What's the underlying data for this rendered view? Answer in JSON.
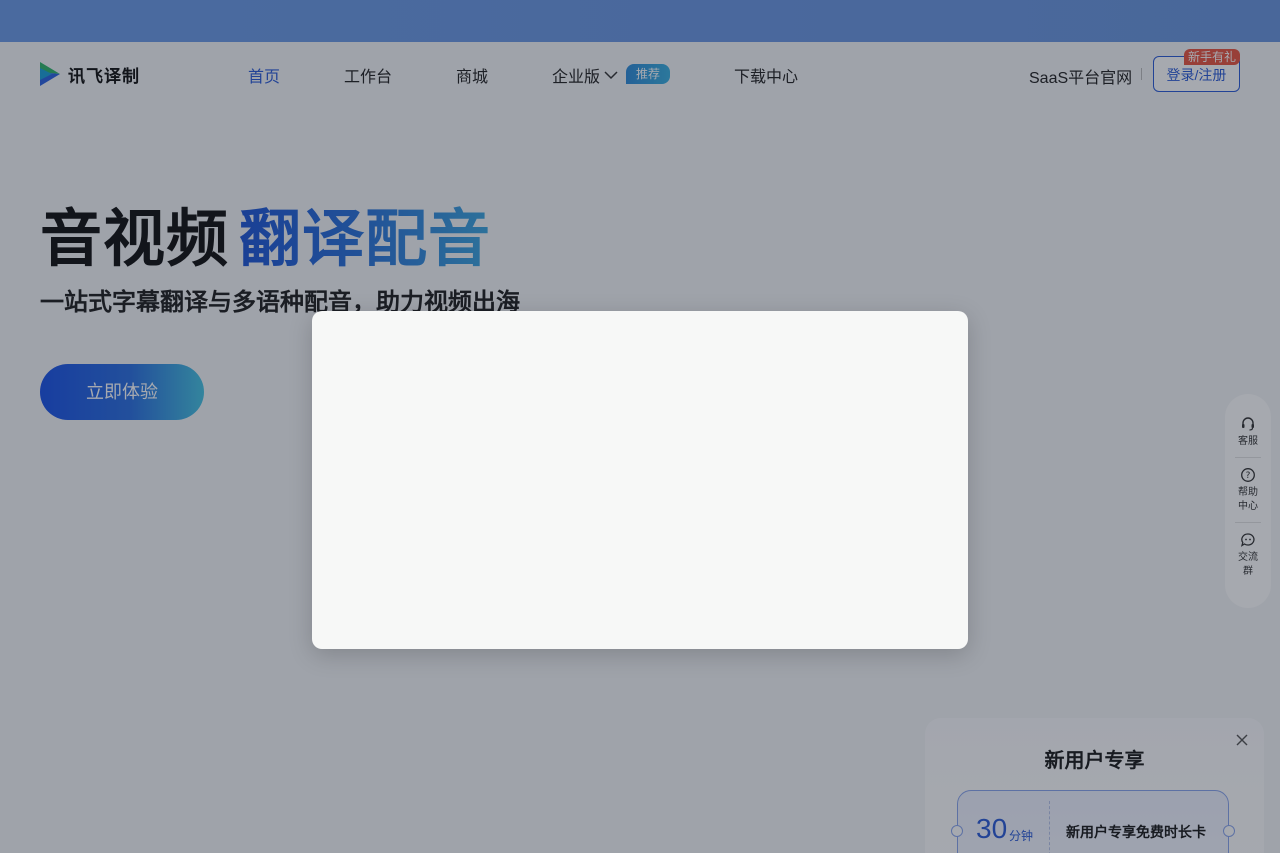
{
  "brand": {
    "name": "讯飞译制",
    "colors": {
      "primary": "#2b5bd7",
      "accent": "#3ca6de",
      "gift": "#e9553f"
    }
  },
  "nav": {
    "items": [
      {
        "label": "首页",
        "active": true
      },
      {
        "label": "工作台",
        "active": false
      },
      {
        "label": "商城",
        "active": false
      },
      {
        "label": "企业版",
        "active": false
      },
      {
        "label": "下载中心",
        "active": false
      }
    ],
    "recommend_badge": "推荐",
    "saas_link": "SaaS平台官网",
    "login_button": "登录/注册",
    "gift_badge": "新手有礼"
  },
  "hero": {
    "title_main": "音视频",
    "title_highlight": "翻译配音",
    "subtitle": "一站式字幕翻译与多语种配音，助力视频出海",
    "cta_label": "立即体验"
  },
  "sidebar": {
    "items": [
      {
        "label": "客服",
        "icon": "headset-icon"
      },
      {
        "label": "帮助中心",
        "icon": "help-icon"
      },
      {
        "label": "交流群",
        "icon": "chat-icon"
      }
    ]
  },
  "promo": {
    "title": "新用户专享",
    "coupon": {
      "amount": "30",
      "unit": "分钟",
      "description": "新用户专享免费时长卡"
    }
  }
}
